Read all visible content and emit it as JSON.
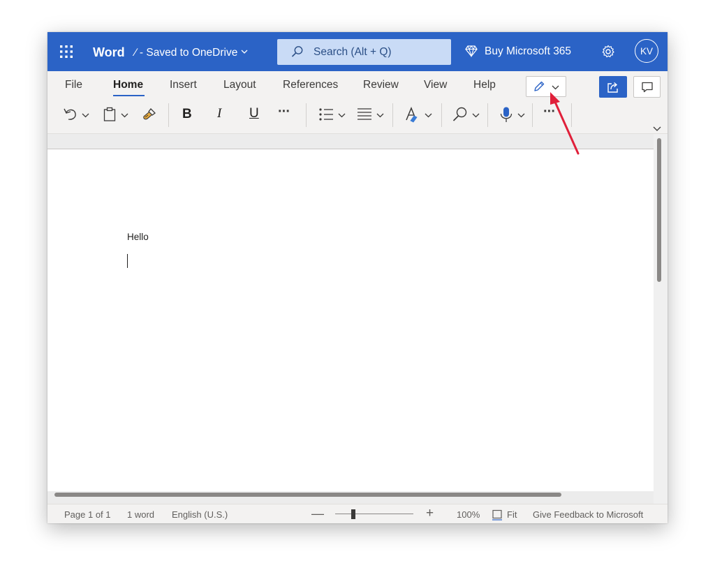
{
  "titlebar": {
    "app_name": "Word",
    "doc_status": "∕ - Saved to OneDrive",
    "search_placeholder": "Search (Alt + Q)",
    "buy_label": "Buy Microsoft 365",
    "avatar_initials": "KV",
    "color": "#2b63c6"
  },
  "ribbon": {
    "tabs": [
      {
        "label": "File"
      },
      {
        "label": "Home"
      },
      {
        "label": "Insert"
      },
      {
        "label": "Layout"
      },
      {
        "label": "References"
      },
      {
        "label": "Review"
      },
      {
        "label": "View"
      },
      {
        "label": "Help"
      }
    ],
    "active_tab": "Home",
    "tools": {
      "bold": "B",
      "italic": "I",
      "underline": "U",
      "more1": "···",
      "more2": "···"
    },
    "icons": [
      "undo-icon",
      "clipboard-icon",
      "format-painter-icon",
      "bullets-icon",
      "align-icon",
      "font-style-icon",
      "find-icon",
      "dictate-icon",
      "pencil-icon",
      "share-icon",
      "comments-icon",
      "gear-icon",
      "diamond-icon",
      "waffle-icon"
    ]
  },
  "document": {
    "text": "Hello"
  },
  "status": {
    "page": "Page 1 of 1",
    "words": "1 word",
    "language": "English (U.S.)",
    "zoom_minus": "—",
    "zoom_plus": "+",
    "zoom_level": "100%",
    "zoom_fraction": 0.23,
    "fit": "Fit",
    "feedback": "Give Feedback to Microsoft"
  },
  "annotation_color": "#e0203a"
}
